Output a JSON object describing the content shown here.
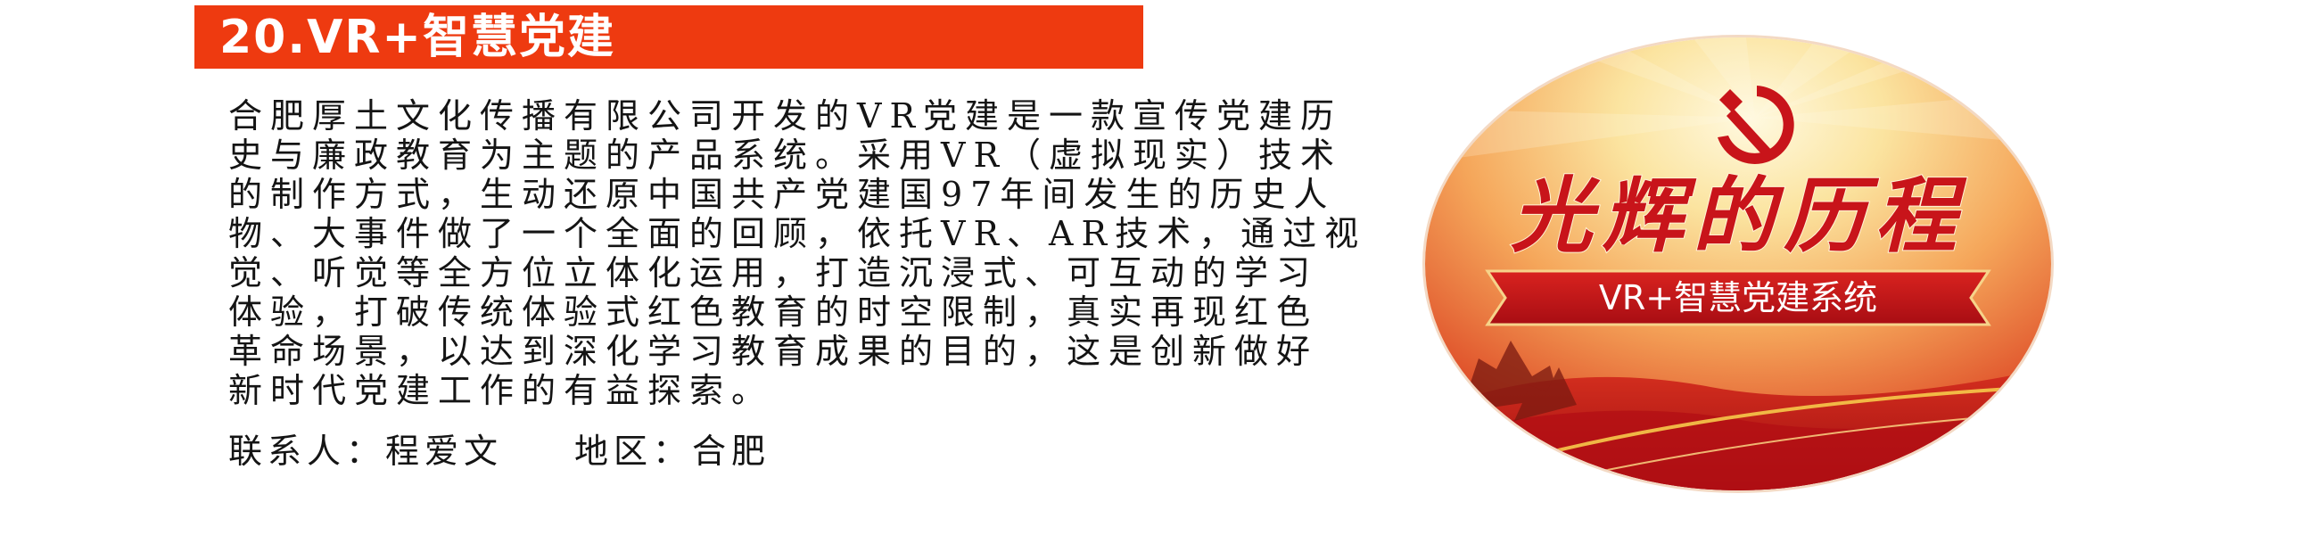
{
  "header": {
    "title": "20.VR+智慧党建"
  },
  "description": {
    "lines": [
      "合肥厚土文化传播有限公司开发的VR党建是一款宣传党建历",
      "史与廉政教育为主题的产品系统。采用VR（虚拟现实）技术",
      "的制作方式，生动还原中国共产党建国97年间发生的历史人",
      "物、大事件做了一个全面的回顾，依托VR、AR技术，通过视",
      "觉、听觉等全方位立体化运用，打造沉浸式、可互动的学习",
      "体验，打破传统体验式红色教育的时空限制，真实再现红色",
      "革命场景，以达到深化学习教育成果的目的，这是创新做好",
      "新时代党建工作的有益探索。"
    ]
  },
  "contact": {
    "person_label": "联系人：程爱文",
    "region_label": "地区：合肥"
  },
  "banner": {
    "headline": "光辉的历程",
    "subtitle": "VR+智慧党建系统",
    "emblem_icon": "hammer-and-sickle-icon",
    "colors": {
      "title_bar": "#ee3a10",
      "banner_red": "#c8141a",
      "banner_gold": "#fbe4a0"
    }
  }
}
